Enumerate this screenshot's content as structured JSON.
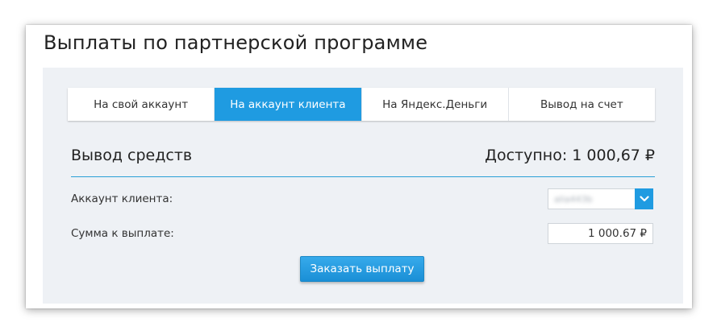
{
  "page": {
    "title": "Выплаты по партнерской программе"
  },
  "tabs": [
    {
      "label": "На свой аккаунт",
      "active": false
    },
    {
      "label": "На аккаунт клиента",
      "active": true
    },
    {
      "label": "На Яндекс.Деньги",
      "active": false
    },
    {
      "label": "Вывод на счет",
      "active": false
    }
  ],
  "withdrawal": {
    "title": "Вывод средств",
    "available": "Доступно: 1 000,67 ₽",
    "client_account_label": "Аккаунт клиента:",
    "client_account_value": "alia443b",
    "amount_label": "Сумма к выплате:",
    "amount_value": "1 000.67 ₽",
    "submit_label": "Заказать выплату"
  },
  "colors": {
    "accent": "#1f9be1",
    "panel_background": "#eef1f5",
    "divider": "#2a9fd6"
  },
  "icons": {
    "select_arrow": "chevron-down-icon"
  }
}
